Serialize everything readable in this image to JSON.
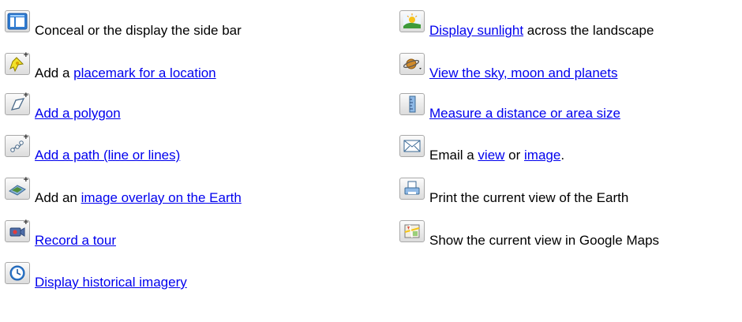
{
  "left_items": [
    {
      "icon": "sidebar-icon",
      "parts": [
        {
          "text": "Conceal or the display the side bar",
          "link": false
        }
      ]
    },
    {
      "icon": "placemark-icon",
      "parts": [
        {
          "text": "Add a ",
          "link": false
        },
        {
          "text": "placemark for a location",
          "link": true
        }
      ]
    },
    {
      "icon": "polygon-icon",
      "parts": [
        {
          "text": "Add a polygon",
          "link": true
        }
      ]
    },
    {
      "icon": "path-icon",
      "parts": [
        {
          "text": "Add a path (line or lines)",
          "link": true
        }
      ]
    },
    {
      "icon": "image-overlay-icon",
      "parts": [
        {
          "text": "Add an ",
          "link": false
        },
        {
          "text": "image overlay on the Earth",
          "link": true
        }
      ]
    },
    {
      "icon": "record-tour-icon",
      "parts": [
        {
          "text": "Record a tour",
          "link": true
        }
      ]
    },
    {
      "icon": "clock-icon",
      "parts": [
        {
          "text": "Display historical imagery",
          "link": true
        }
      ]
    }
  ],
  "right_items": [
    {
      "icon": "sunlight-icon",
      "parts": [
        {
          "text": "Display sunlight",
          "link": true
        },
        {
          "text": " across the landscape",
          "link": false
        }
      ]
    },
    {
      "icon": "planet-icon",
      "parts": [
        {
          "text": "View the sky, moon and planets",
          "link": true
        }
      ]
    },
    {
      "icon": "ruler-icon",
      "parts": [
        {
          "text": "Measure a distance or area size",
          "link": true
        }
      ]
    },
    {
      "icon": "email-icon",
      "parts": [
        {
          "text": "Email a ",
          "link": false
        },
        {
          "text": "view",
          "link": true
        },
        {
          "text": " or ",
          "link": false
        },
        {
          "text": "image",
          "link": true
        },
        {
          "text": ".",
          "link": false
        }
      ]
    },
    {
      "icon": "print-icon",
      "parts": [
        {
          "text": "Print the current view of the Earth",
          "link": false
        }
      ]
    },
    {
      "icon": "google-maps-icon",
      "parts": [
        {
          "text": "Show the current view in Google Maps",
          "link": false
        }
      ]
    }
  ]
}
